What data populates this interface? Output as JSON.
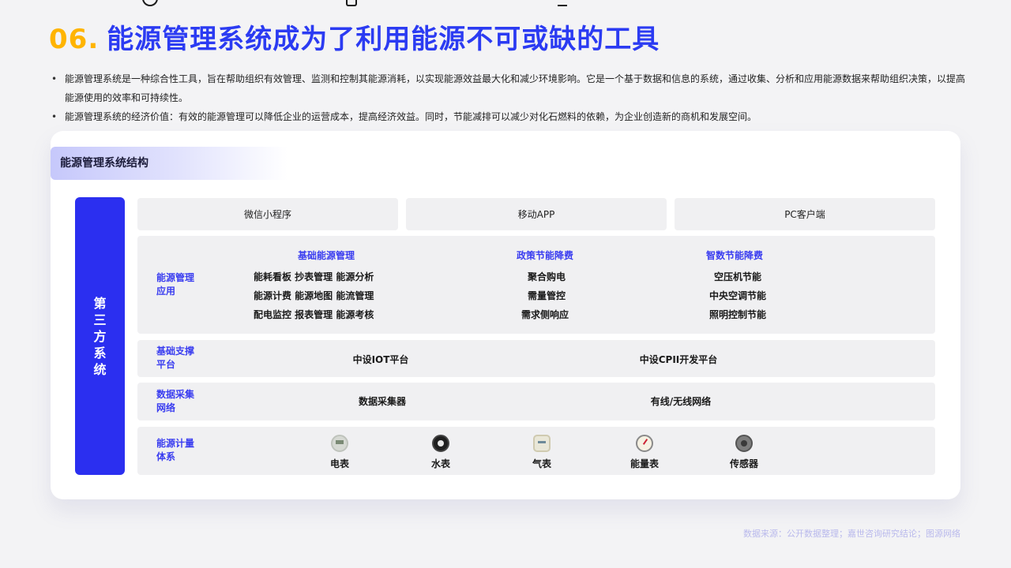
{
  "header": {
    "number": "06.",
    "title": "能源管理系统成为了利用能源不可或缺的工具"
  },
  "bullets": [
    "能源管理系统是一种综合性工具，旨在帮助组织有效管理、监测和控制其能源消耗，以实现能源效益最大化和减少环境影响。它是一个基于数据和信息的系统，通过收集、分析和应用能源数据来帮助组织决策，以提高能源使用的效率和可持续性。",
    "能源管理系统的经济价值：有效的能源管理可以降低企业的运营成本，提高经济效益。同时，节能减排可以减少对化石燃料的依赖，为企业创造新的商机和发展空间。"
  ],
  "diagram": {
    "title": "能源管理系统结构",
    "side_label": "第三方系统",
    "clients": [
      "微信小程序",
      "移动APP",
      "PC客户端"
    ],
    "application": {
      "label": "能源管理应用",
      "groups": [
        {
          "title": "基础能源管理",
          "rows": [
            "能耗看板  抄表管理  能源分析",
            "能源计费  能源地图  能流管理",
            "配电监控  报表管理  能源考核"
          ]
        },
        {
          "title": "政策节能降费",
          "rows": [
            "聚合购电",
            "需量管控",
            "需求侧响应"
          ]
        },
        {
          "title": "智数节能降费",
          "rows": [
            "空压机节能",
            "中央空调节能",
            "照明控制节能"
          ]
        }
      ]
    },
    "platform": {
      "label": "基础支撑平台",
      "items": [
        "中设IOT平台",
        "中设CPII开发平台"
      ]
    },
    "collection": {
      "label": "数据采集网络",
      "items": [
        "数据采集器",
        "有线/无线网络"
      ]
    },
    "metering": {
      "label": "能源计量体系",
      "items": [
        {
          "label": "电表",
          "icon": "electric-meter-icon"
        },
        {
          "label": "水表",
          "icon": "water-meter-icon"
        },
        {
          "label": "气表",
          "icon": "gas-meter-icon"
        },
        {
          "label": "能量表",
          "icon": "energy-meter-icon"
        },
        {
          "label": "传感器",
          "icon": "sensor-icon"
        }
      ]
    }
  },
  "source": "数据来源：公开数据整理；嘉世咨询研究结论；图源网络",
  "colors": {
    "accent": "#2b3bf2",
    "number": "#ffb400",
    "sidebar": "#2b2ff0",
    "panel": "#f0f0f2"
  }
}
